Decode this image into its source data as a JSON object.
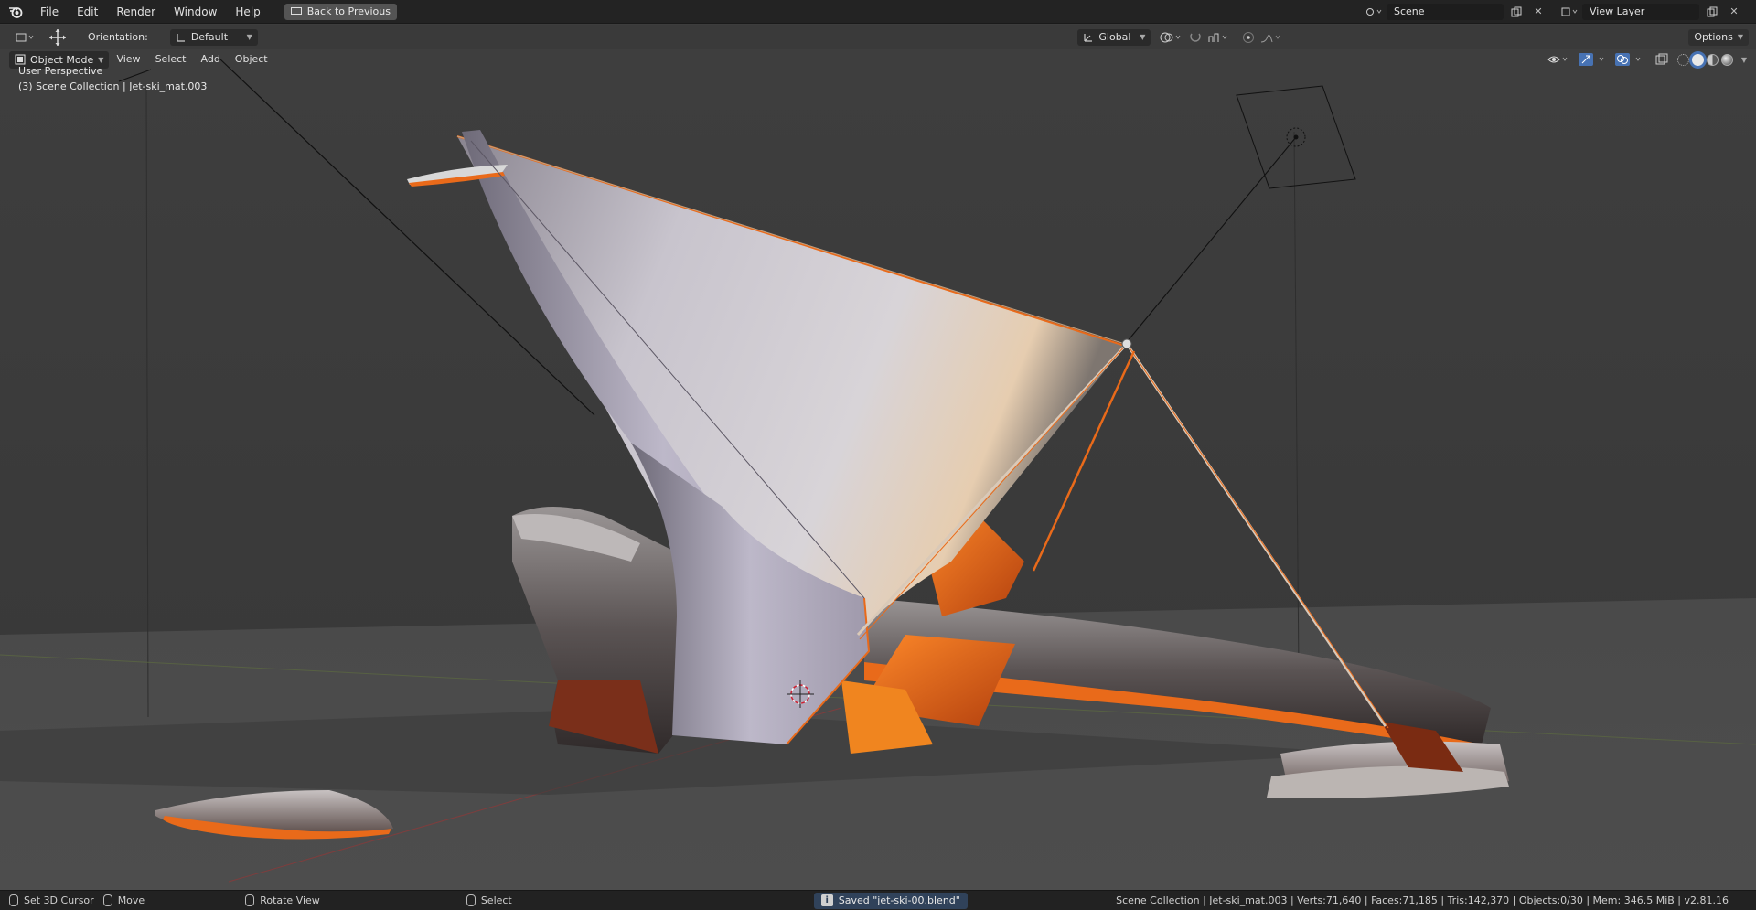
{
  "topbar": {
    "menus": [
      "File",
      "Edit",
      "Render",
      "Window",
      "Help"
    ],
    "back_label": "Back to Previous",
    "scene_name": "Scene",
    "view_layer_name": "View Layer"
  },
  "toolbar": {
    "orientation_label": "Orientation:",
    "orientation_value": "Default",
    "transform_space": "Global",
    "options_label": "Options"
  },
  "viewport": {
    "mode": "Object Mode",
    "menus": [
      "View",
      "Select",
      "Add",
      "Object"
    ],
    "perspective_label": "User Perspective",
    "collection_label": "(3) Scene Collection | Jet-ski_mat.003"
  },
  "status": {
    "set_cursor": "Set 3D Cursor",
    "move": "Move",
    "rotate": "Rotate View",
    "select": "Select",
    "saved_message": "Saved \"jet-ski-00.blend\"",
    "stats": "Scene Collection | Jet-ski_mat.003 | Verts:71,640 | Faces:71,185 | Tris:142,370 | Objects:0/30 | Mem: 346.5 MiB | v2.81.16"
  },
  "icons": {
    "logo": "blender-logo-icon",
    "accent": "#e96a1a"
  }
}
